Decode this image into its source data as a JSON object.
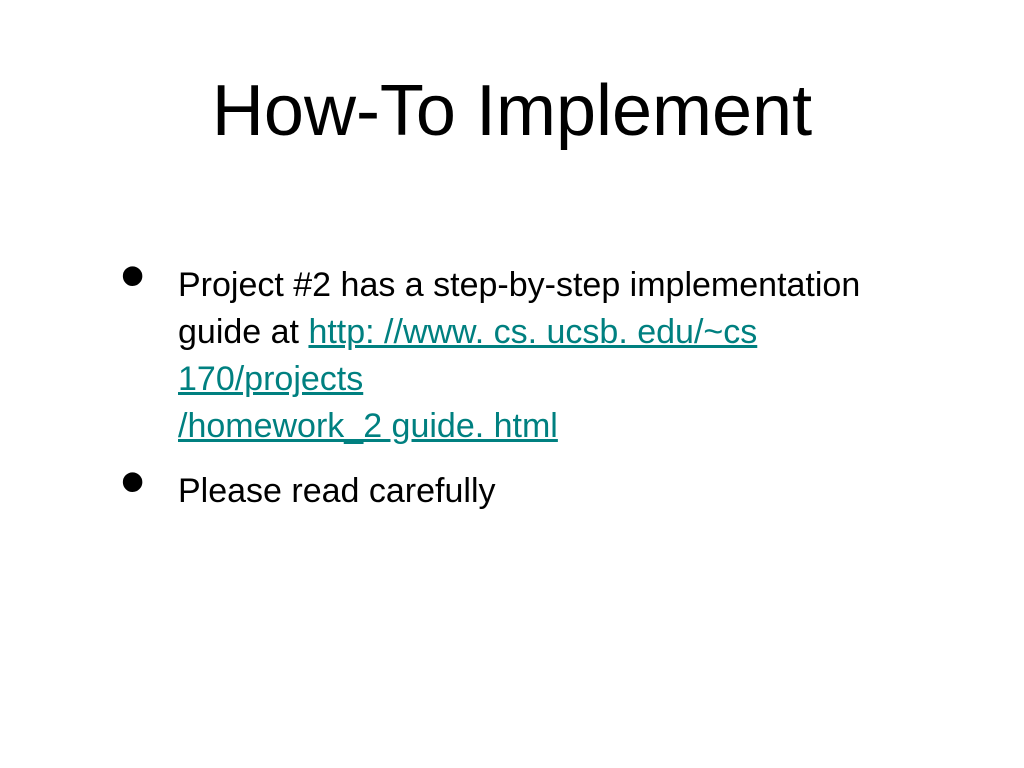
{
  "slide": {
    "title": "How-To Implement",
    "bullets": [
      {
        "text_before_link": "Project #2 has a step-by-step implementation guide at ",
        "link_line1": "http: //www. cs. ucsb. edu/~cs 170/projects",
        "link_line2": "/homework_2 guide. html"
      },
      {
        "text": "Please read carefully"
      }
    ]
  }
}
